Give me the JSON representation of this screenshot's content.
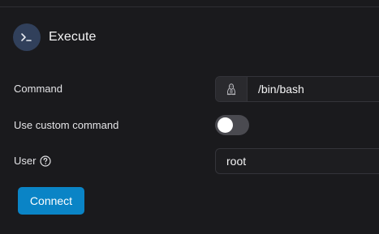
{
  "header": {
    "title": "Execute",
    "icon": "terminal-icon"
  },
  "form": {
    "command": {
      "label": "Command",
      "value": "/bin/bash",
      "prefix_icon": "linux-tux-icon"
    },
    "custom_command": {
      "label": "Use custom command",
      "enabled": false
    },
    "user": {
      "label": "User",
      "help_icon": "help-circle-icon",
      "value": "root"
    }
  },
  "actions": {
    "connect_label": "Connect"
  },
  "colors": {
    "background": "#1a1a1d",
    "accent": "#0a84c6",
    "toggle_off": "#4a4a50",
    "header_icon_bg": "#31405b"
  }
}
